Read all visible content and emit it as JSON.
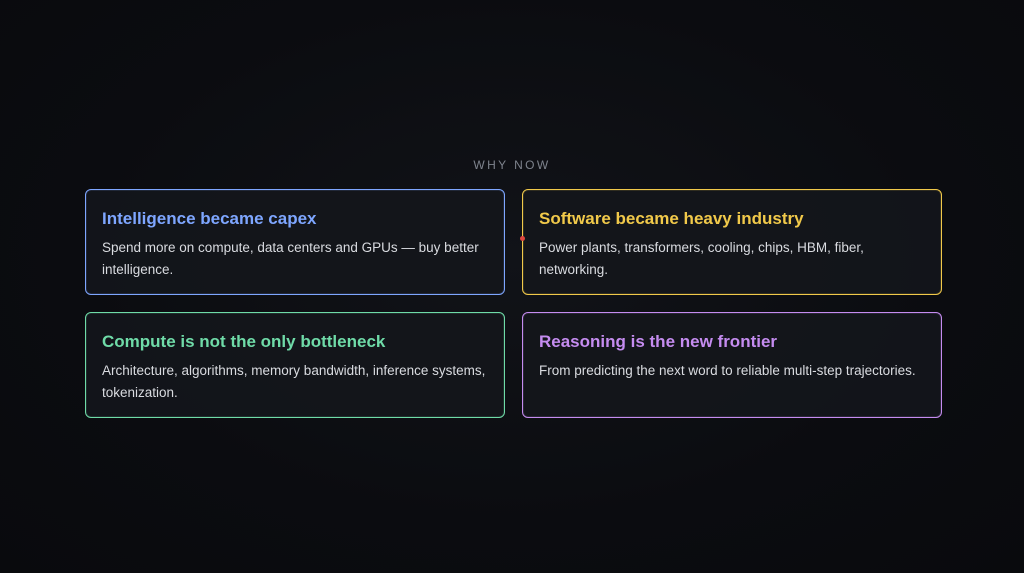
{
  "header": {
    "eyebrow": "WHY NOW"
  },
  "cards": [
    {
      "title": "Intelligence became capex",
      "body": "Spend more on compute, data centers and GPUs — buy better intelligence.",
      "accent_color": "#7ea6ff"
    },
    {
      "title": "Software became heavy industry",
      "body": "Power plants, transformers, cooling, chips, HBM, fiber, networking.",
      "accent_color": "#f1c94a"
    },
    {
      "title": "Compute is not the only bottleneck",
      "body": "Architecture, algorithms, memory bandwidth, inference systems, tokenization.",
      "accent_color": "#6fdba8"
    },
    {
      "title": "Reasoning is the new frontier",
      "body": "From predicting the next word to reliable multi-step trajectories.",
      "accent_color": "#c58cf0"
    }
  ],
  "colors": {
    "background": "#0b0c10",
    "eyebrow": "#7e838d",
    "body_text": "#d9dbe0",
    "pointer_dot": "#e0473f"
  }
}
